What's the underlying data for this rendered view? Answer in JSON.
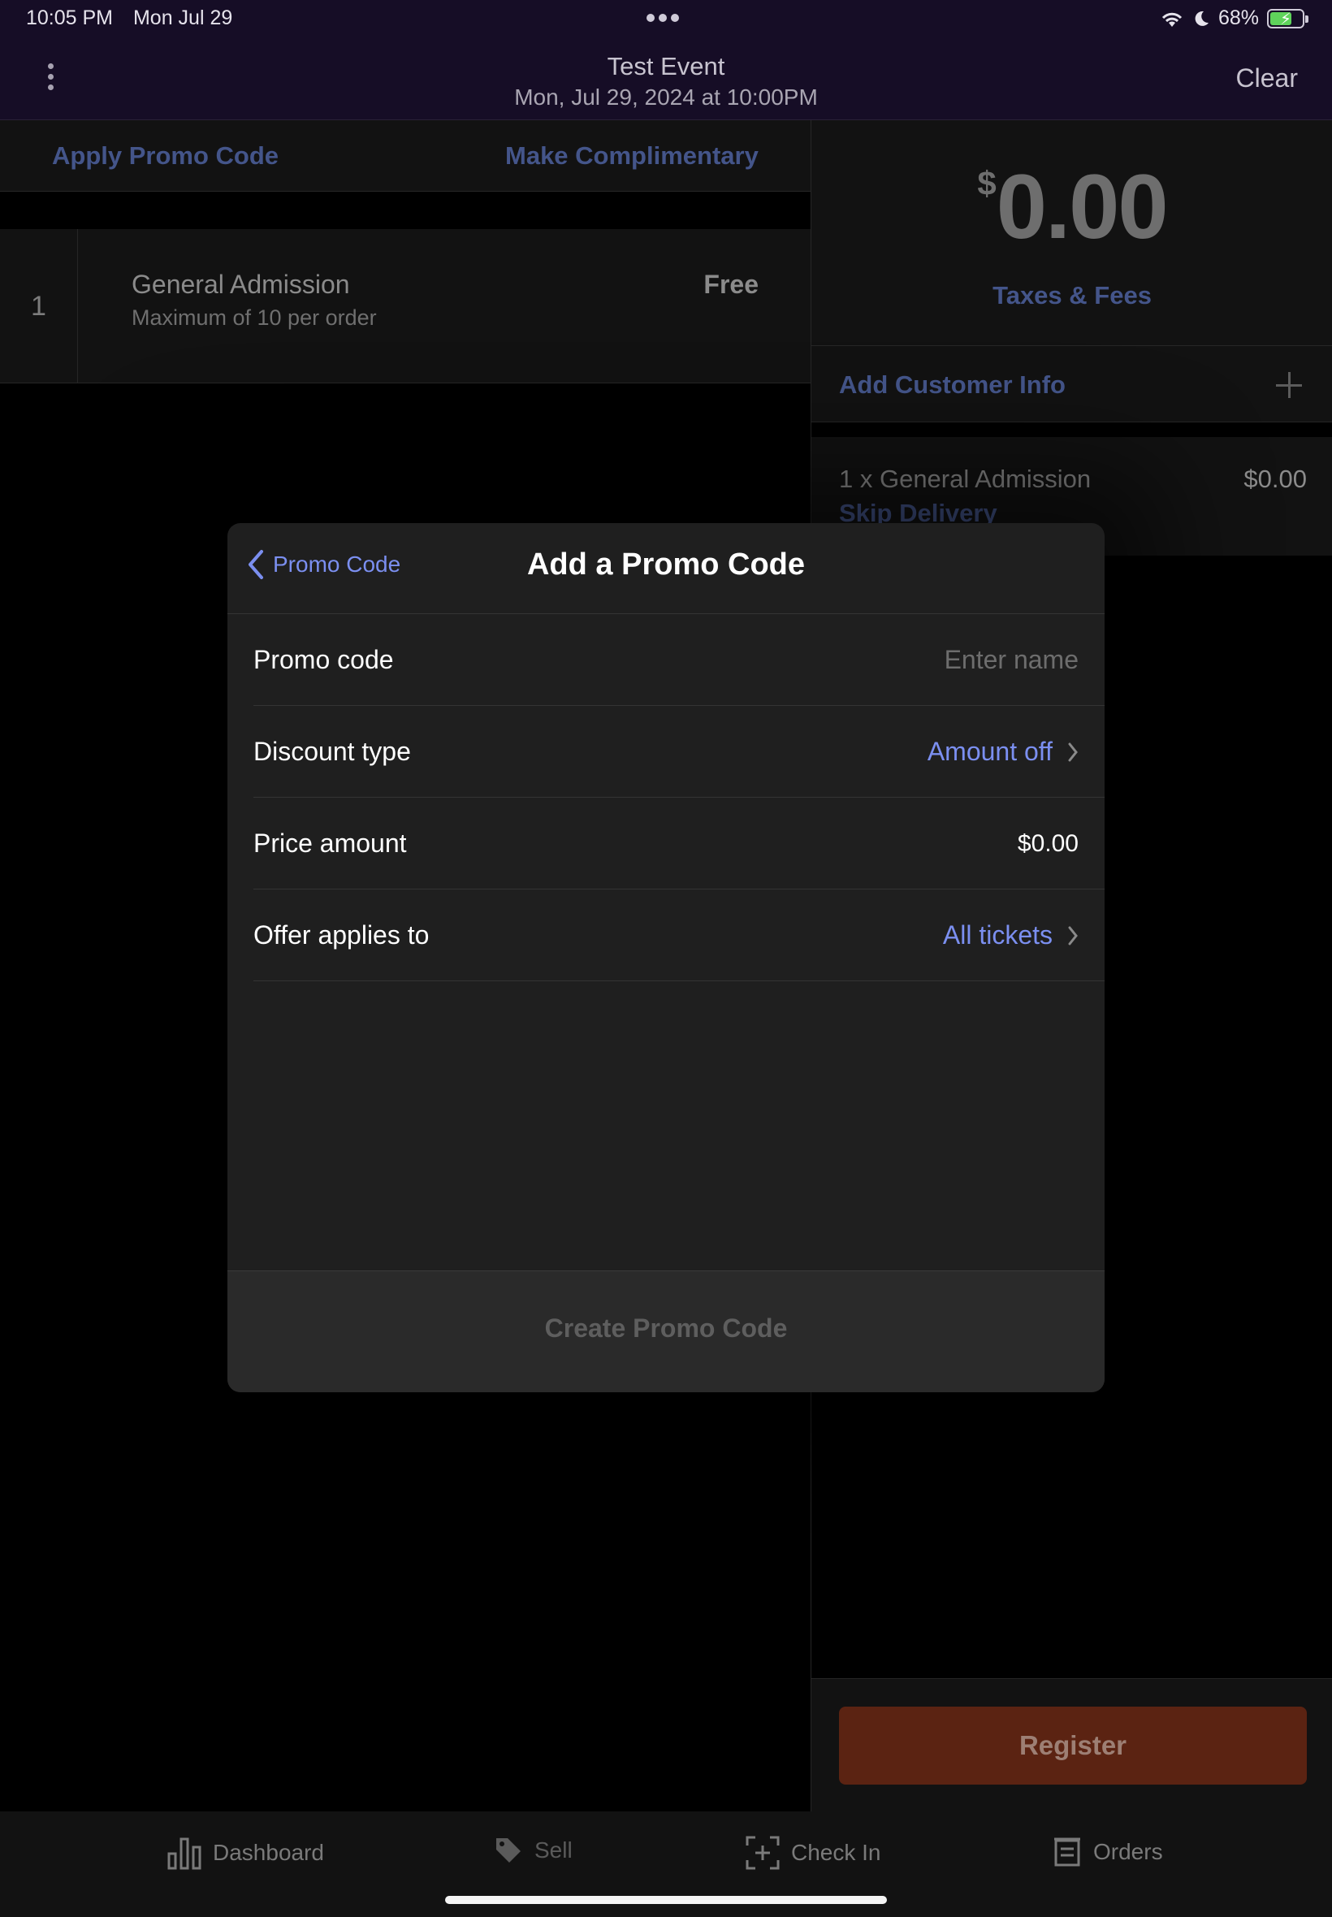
{
  "status_bar": {
    "time": "10:05 PM",
    "date": "Mon Jul 29",
    "battery": "68%",
    "battery_level": 0.68
  },
  "header": {
    "event_title": "Test Event",
    "event_datetime": "Mon, Jul 29, 2024 at 10:00PM",
    "clear_label": "Clear",
    "menu_icon": "more-vertical-icon"
  },
  "left_pane": {
    "apply_promo_label": "Apply Promo Code",
    "make_complimentary_label": "Make Complimentary",
    "ticket": {
      "quantity": "1",
      "name": "General Admission",
      "limit": "Maximum of 10 per order",
      "price": "Free"
    }
  },
  "right_pane": {
    "currency_symbol": "$",
    "total": "0.00",
    "taxes_label": "Taxes & Fees",
    "add_customer_label": "Add Customer Info",
    "cart_item": "1 x General Admission",
    "cart_item_price": "$0.00",
    "delivery_label": "Skip Delivery",
    "register_label": "Register"
  },
  "modal": {
    "back_label": "Promo Code",
    "title": "Add a Promo Code",
    "fields": [
      {
        "label": "Promo code",
        "placeholder": "Enter name"
      },
      {
        "label": "Discount type",
        "value": "Amount off"
      },
      {
        "label": "Price amount",
        "value": "$0.00"
      },
      {
        "label": "Offer applies to",
        "value": "All tickets"
      }
    ],
    "create_label": "Create Promo Code"
  },
  "tabbar": {
    "tabs": [
      {
        "label": "Dashboard",
        "icon": "bar-chart-icon"
      },
      {
        "label": "Sell",
        "icon": "tag-icon"
      },
      {
        "label": "Check In",
        "icon": "scan-icon"
      },
      {
        "label": "Orders",
        "icon": "receipt-icon"
      }
    ]
  },
  "colors": {
    "header_bg": "#160d26",
    "link_blue": "#7b8ff0",
    "dim_link": "#44558a",
    "register_bg": "#5b2312"
  }
}
